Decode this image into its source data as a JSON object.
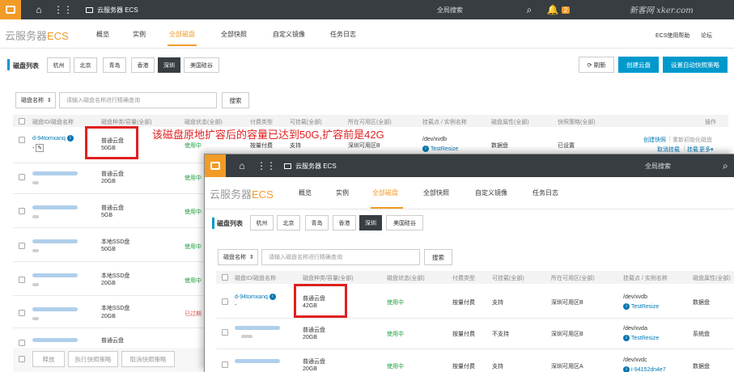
{
  "topbar": {
    "home_icon": "home-icon",
    "grid_icon": "grid-icon",
    "product": "云服务器 ECS",
    "search_placeholder": "全局搜索",
    "badge": "2",
    "watermark": "新客网 xker.com"
  },
  "subnav": {
    "brand": "云服务器",
    "brand_suffix": "ECS",
    "tabs": [
      "概览",
      "实例",
      "全部磁盘",
      "全部快照",
      "自定义镜像",
      "任务日志"
    ],
    "right_links": [
      "ECS使用帮助",
      "论坛"
    ]
  },
  "regions": {
    "label": "磁盘列表",
    "items": [
      "杭州",
      "北京",
      "青岛",
      "香港",
      "深圳",
      "美国硅谷"
    ],
    "selected": "深圳"
  },
  "actions": {
    "refresh": "刷新",
    "create_disk": "创建云盘",
    "auto_snapshot": "设置自动快照策略"
  },
  "filter": {
    "select_value": "磁盘名称",
    "input_placeholder": "请输入磁盘名称进行精确查询",
    "search_button": "搜索"
  },
  "table": {
    "headers": [
      "磁盘ID/磁盘名称",
      "磁盘种类/容量(全部)",
      "磁盘状态(全部)",
      "付费类型",
      "可挂载(全部)",
      "所在可用区(全部)",
      "挂载点 / 实例名称",
      "磁盘属性(全部)",
      "快照策略(全部)",
      "操作"
    ],
    "rows": [
      {
        "id": "d-94tomxanq",
        "name": "-",
        "type": "普通云盘",
        "size": "50GB",
        "status": "使用中",
        "pay": "按量付费",
        "mount": "支持",
        "zone": "深圳可用区B",
        "dev": "/dev/xvdb",
        "instance": "TestResize",
        "attr": "数据盘",
        "policy": "已设置",
        "op1": "创建快照",
        "op2": "重新初始化磁盘",
        "op3": "取消挂载",
        "op4": "挂载",
        "op5": "更多"
      },
      {
        "type": "普通云盘",
        "size": "20GB",
        "status": "使用中"
      },
      {
        "type": "普通云盘",
        "size": "5GB",
        "status": "使用中"
      },
      {
        "type": "本地SSD盘",
        "size": "50GB",
        "status": "使用中"
      },
      {
        "type": "本地SSD盘",
        "size": "20GB",
        "status": "使用中"
      },
      {
        "type": "本地SSD盘",
        "size": "20GB",
        "status": "已过期"
      },
      {
        "type": "普通云盘",
        "size": "20GB",
        "status": ""
      }
    ]
  },
  "bottom": [
    "释放",
    "执行快照策略",
    "取消快照策略"
  ],
  "annotation": "该磁盘原地扩容后的容量已达到50G,扩容前是42G",
  "overlay": {
    "headers": [
      "磁盘ID/磁盘名称",
      "磁盘种类/容量(全部)",
      "磁盘状态(全部)",
      "付费类型",
      "可挂载(全部)",
      "所在可用区(全部)",
      "挂载点 / 实例名称",
      "磁盘属性(全部)"
    ],
    "rows": [
      {
        "id": "d-94tomxanq",
        "name": "-",
        "type": "普通云盘",
        "size": "42GB",
        "status": "使用中",
        "pay": "按量付费",
        "mount": "支持",
        "zone": "深圳可用区B",
        "dev": "/dev/xvdb",
        "instance": "TestResize",
        "attr": "数据盘"
      },
      {
        "id": "",
        "name": "",
        "type": "普通云盘",
        "size": "20GB",
        "status": "使用中",
        "pay": "按量付费",
        "mount": "不支持",
        "zone": "深圳可用区B",
        "dev": "/dev/xvda",
        "instance": "TestResize",
        "attr": "系统盘"
      },
      {
        "type": "普通云盘",
        "size": "20GB",
        "status": "使用中",
        "pay": "按量付费",
        "mount": "支持",
        "zone": "深圳可用区A",
        "dev": "/dev/xvdc",
        "instance": "i-94152dn4e7",
        "attr": "数据盘"
      }
    ]
  }
}
